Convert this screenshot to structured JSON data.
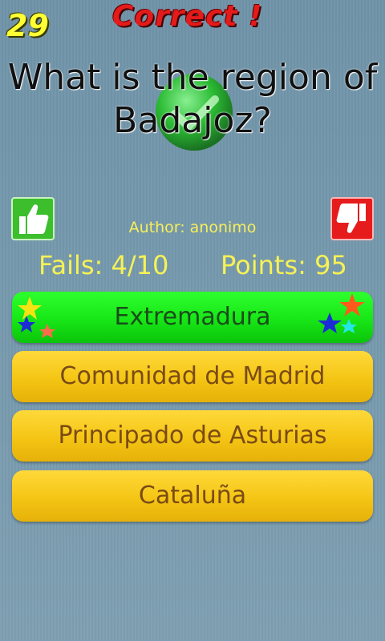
{
  "header": {
    "counter": "29",
    "result": "Correct !"
  },
  "question": {
    "text": "What is the region of Badajoz?"
  },
  "author": "Author: anonimo",
  "stats": {
    "fails": "Fails: 4/10",
    "points": "Points: 95"
  },
  "answers": [
    {
      "label": "Extremadura",
      "state": "correct"
    },
    {
      "label": "Comunidad de Madrid",
      "state": "normal"
    },
    {
      "label": "Principado de Asturias",
      "state": "normal"
    },
    {
      "label": "Cataluña",
      "state": "normal"
    }
  ],
  "icons": {
    "like": "thumbs-up-icon",
    "dislike": "thumbs-down-icon",
    "result": "check-icon"
  },
  "colors": {
    "correct": "#17e617",
    "answer": "#f4c514",
    "like": "#3cbe2d",
    "dislike": "#e61c1c"
  }
}
